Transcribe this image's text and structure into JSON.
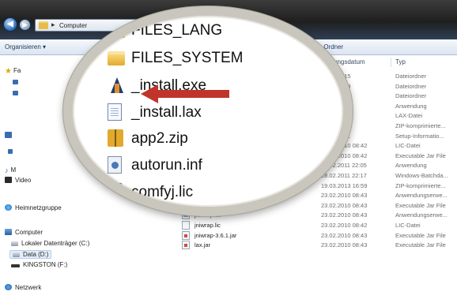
{
  "window": {
    "address_text": "Computer",
    "address_separator": "▸",
    "nav_back_icon": "back-arrow-icon",
    "nav_forward_icon": "forward-arrow-icon"
  },
  "toolbar": {
    "organize_label": "Organisieren ▾",
    "new_folder_label": "er Ordner"
  },
  "columns": {
    "date_header": "nderungsdatum",
    "type_header": "Typ"
  },
  "navigation": {
    "favorites_label": "Fa",
    "music_label": "M",
    "videos_label": "Video",
    "homegroup_label": "Heimnetzgruppe",
    "computer_label": "Computer",
    "local_disk_label": "Lokaler Datenträger (C:)",
    "data_drive_label": "Data (D:)",
    "usb_label": "KINGSTON (F:)",
    "network_label": "Netzwerk"
  },
  "magnified_items": [
    {
      "name": "FILES_LANG",
      "icon": "folder-icon"
    },
    {
      "name": "FILES_SYSTEM",
      "icon": "folder-icon"
    },
    {
      "name": "_install.exe",
      "icon": "installer-exe-icon"
    },
    {
      "name": "_install.lax",
      "icon": "text-document-icon"
    },
    {
      "name": "app2.zip",
      "icon": "zip-archive-icon"
    },
    {
      "name": "autorun.inf",
      "icon": "settings-file-icon"
    },
    {
      "name": "comfyj.lic",
      "icon": "text-document-icon"
    }
  ],
  "file_rows": [
    {
      "name": "",
      "date": "2013 05:15",
      "type": "Dateiordner"
    },
    {
      "name": "",
      "date": "2013 05:19",
      "type": "Dateiordner"
    },
    {
      "name": "",
      "date": "2013 05:19",
      "type": "Dateiordner"
    },
    {
      "name": "",
      "date": "2010 08:42",
      "type": "Anwendung"
    },
    {
      "name": "",
      "date": "2010 08:43",
      "type": "LAX-Datei"
    },
    {
      "name": "",
      "date": "2010 08:42",
      "type": "ZIP-komprimierte..."
    },
    {
      "name": "",
      "date": "2011 22:21",
      "type": "Setup-Informatio..."
    },
    {
      "name": "",
      "date": "23.02.2010 08:42",
      "type": "LIC-Datei"
    },
    {
      "name": "",
      "date": "23.02.2010 08:42",
      "type": "Executable Jar File"
    },
    {
      "name": "",
      "date": "28.02.2011 22:05",
      "type": "Anwendung"
    },
    {
      "name": "",
      "date": "28.02.2011 22:17",
      "type": "Windows-Batchda..."
    },
    {
      "name": "",
      "date": "19.03.2013 16:59",
      "type": "ZIP-komprimierte..."
    },
    {
      "name": "jawin.dll",
      "date": "23.02.2010 08:43",
      "type": "Anwendungserwe..."
    },
    {
      "name": "jawin.jar",
      "date": "23.02.2010 08:43",
      "type": "Executable Jar File"
    },
    {
      "name": "jniwrap.dll",
      "date": "23.02.2010 08:43",
      "type": "Anwendungserwe..."
    },
    {
      "name": "jniwrap.lic",
      "date": "23.02.2010 08:42",
      "type": "LIC-Datei"
    },
    {
      "name": "jniwrap-3.6.1.jar",
      "date": "23.02.2010 08:43",
      "type": "Executable Jar File"
    },
    {
      "name": "lax.jar",
      "date": "23.02.2010 08:43",
      "type": "Executable Jar File"
    }
  ],
  "colors": {
    "arrow": "#c0352b",
    "magnifier_rim": "#c9c6bd",
    "titlebar": "#1f1f1f"
  }
}
